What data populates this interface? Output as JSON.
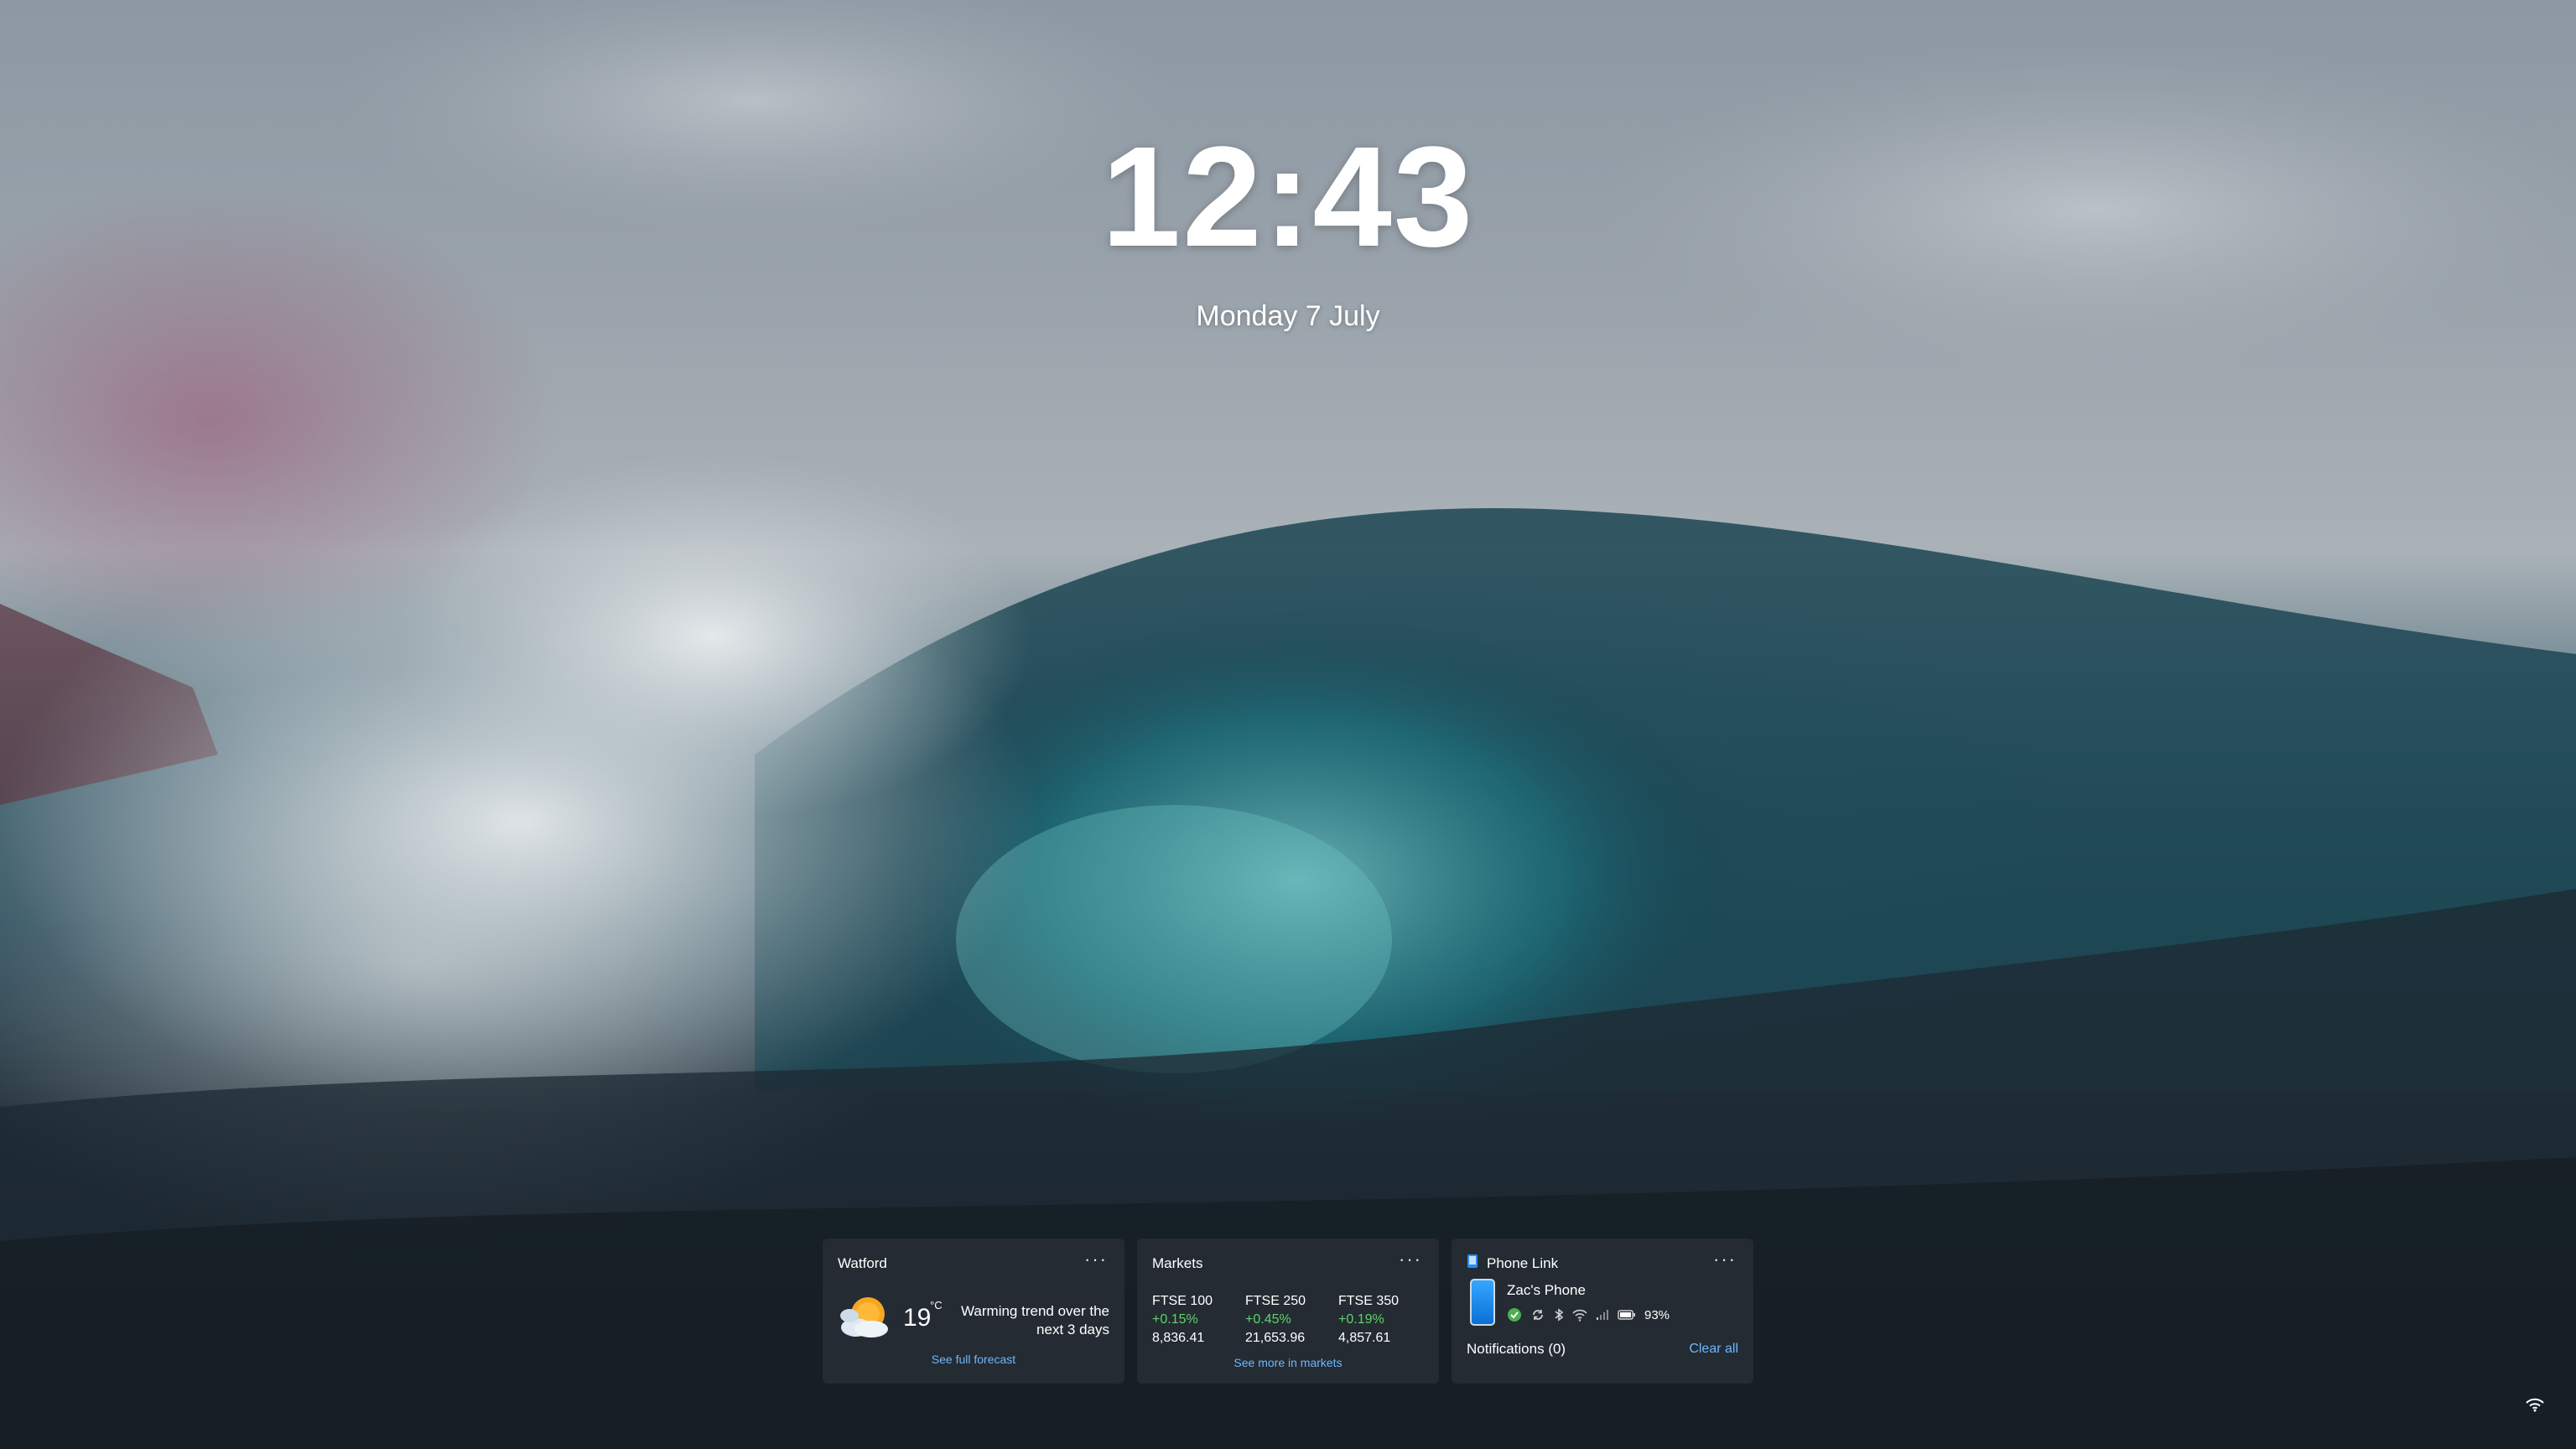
{
  "lockscreen": {
    "time": "12:43",
    "date": "Monday 7 July"
  },
  "weather_widget": {
    "title": "Watford",
    "menu": "···",
    "icon": "partly-sunny-icon",
    "temperature": "19",
    "unit": "°C",
    "summary": "Warming trend over the next 3 days",
    "link": "See full forecast"
  },
  "markets_widget": {
    "title": "Markets",
    "menu": "···",
    "stocks": [
      {
        "name": "FTSE 100",
        "change": "+0.15%",
        "value": "8,836.41"
      },
      {
        "name": "FTSE 250",
        "change": "+0.45%",
        "value": "21,653.96"
      },
      {
        "name": "FTSE 350",
        "change": "+0.19%",
        "value": "4,857.61"
      }
    ],
    "link": "See more in markets"
  },
  "phone_widget": {
    "title": "Phone Link",
    "menu": "···",
    "device_name": "Zac's Phone",
    "battery": "93%",
    "notifications": "Notifications (0)",
    "clear": "Clear all"
  },
  "colors": {
    "accent_link": "#6cb8ff",
    "positive": "#5fd36a",
    "widget_bg": "#262c34"
  }
}
